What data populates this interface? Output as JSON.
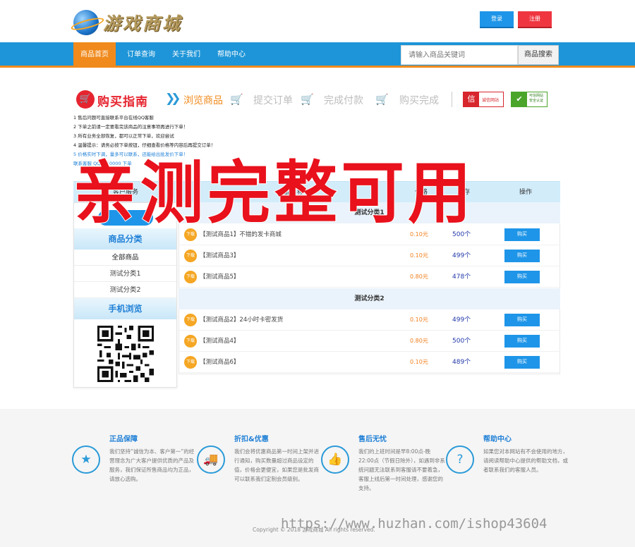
{
  "header": {
    "logo_text": "游戏商城",
    "login_label": "登录",
    "register_label": "注册"
  },
  "nav": {
    "items": [
      "商品首页",
      "订单查询",
      "关于我们",
      "帮助中心"
    ],
    "active_index": 0,
    "search_placeholder": "请输入商品关键词",
    "search_button": "商品搜索"
  },
  "guide": {
    "title": "购买指南",
    "steps": [
      "浏览商品",
      "提交订单",
      "完成付款",
      "购买完成"
    ],
    "badge_trust": "诚信网站",
    "badge_trust_icon_text": "信",
    "badge_safe": "可信网站 安全认证"
  },
  "notices": [
    "1  售后问题可直接联系平台在线QQ客服",
    "2  下单之前请一定要看完该商品的注意事项再进行下单！",
    "3  所有业务全部恢复，都可以正常下单，欢迎尝试",
    "4  温馨提示：请务必按下单按钮，仔细查看价格等内容后再提交订单！",
    "5  价格实时下调，量多可以联系，还能给出批发价下单！",
    "联系客服 QQ：  10000 下单"
  ],
  "table": {
    "headers": [
      "客户服务",
      "商品名称",
      "价格",
      "库存",
      "操作"
    ]
  },
  "stamp_text": "亲测完整可用",
  "sidebar": {
    "category_title": "商品分类",
    "categories": [
      "全部商品",
      "测试分类1",
      "测试分类2"
    ],
    "mobile_title": "手机浏览"
  },
  "groups": [
    {
      "name": "测试分类1",
      "products": [
        {
          "badge": "下载",
          "name": "【测试商品1】不错的发卡商城",
          "price": "0.10元",
          "stock": "500个",
          "buy": "购买"
        },
        {
          "badge": "下载",
          "name": "【测试商品3】",
          "price": "0.10元",
          "stock": "499个",
          "buy": "购买"
        },
        {
          "badge": "下载",
          "name": "【测试商品5】",
          "price": "0.80元",
          "stock": "478个",
          "buy": "购买"
        }
      ]
    },
    {
      "name": "测试分类2",
      "products": [
        {
          "badge": "下载",
          "name": "【测试商品2】24小时卡密发货",
          "price": "0.10元",
          "stock": "499个",
          "buy": "购买"
        },
        {
          "badge": "下载",
          "name": "【测试商品4】",
          "price": "0.80元",
          "stock": "500个",
          "buy": "购买"
        },
        {
          "badge": "下载",
          "name": "【测试商品6】",
          "price": "0.10元",
          "stock": "489个",
          "buy": "购买"
        }
      ]
    }
  ],
  "footer": {
    "features": [
      {
        "icon": "award-icon",
        "title": "正品保障",
        "desc": "我们坚持“诚信为本、客户第一”的经营理念为广大客户提供优质的产品及服务，我们保证所售商品均为正品，请放心选购。"
      },
      {
        "icon": "truck-icon",
        "title": "折扣&优惠",
        "desc": "我们会将优惠商品第一时间上架并进行通知，购买数量超过商品设定的值，价格会更便宜，如果您是批发商可以联系我们定制会员级别。"
      },
      {
        "icon": "thumbs-up-icon",
        "title": "售后无忧",
        "desc": "我们的上班时间是早8:00点-晚22:00点（节假日除外），如遇到非系统问题无法联系到客服请不要着急，客服上线后第一时间处理，感谢您的支持。"
      },
      {
        "icon": "question-icon",
        "title": "帮助中心",
        "desc": "如果您对本网站有不会使用的地方，请阅读帮助中心提供的帮助文档，或者联系我们的客服人员。"
      }
    ],
    "copyright": "Copyright © 2018 游戏商城 All rights reserved.",
    "watermark": "https://www.huzhan.com/ishop43604"
  }
}
